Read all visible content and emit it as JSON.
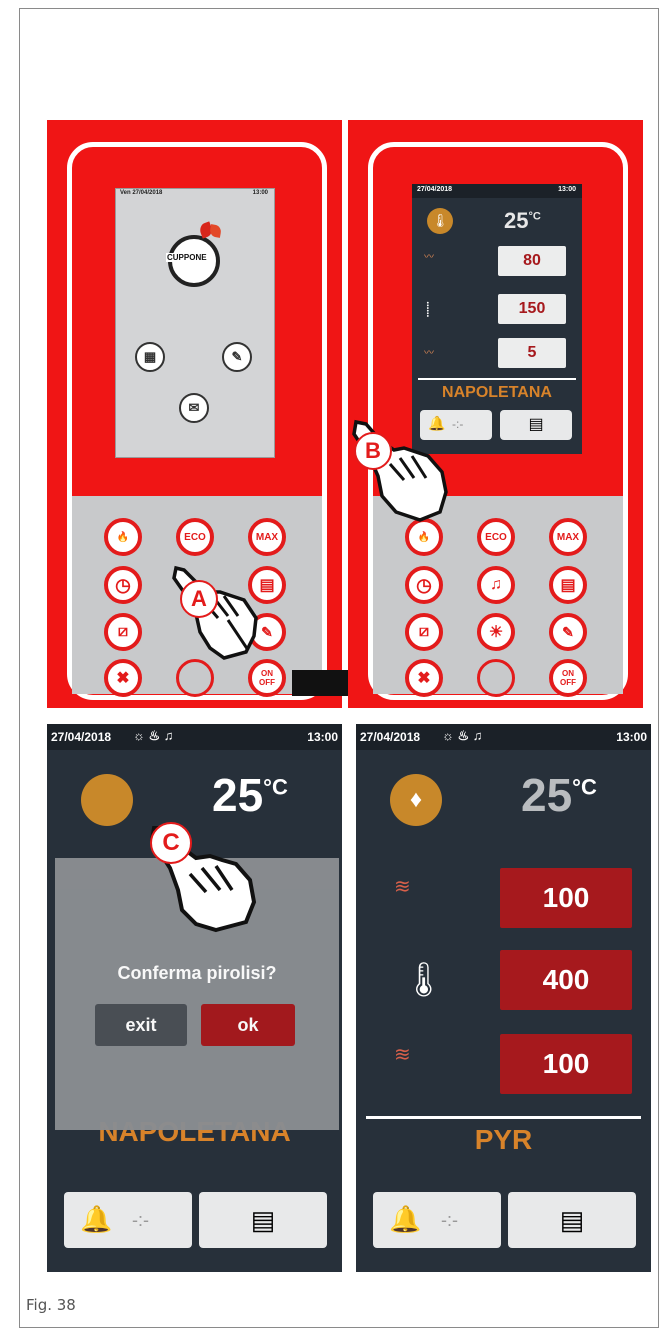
{
  "figure_caption": "Fig. 38",
  "panel_a": {
    "date": "Ven 27/04/2018",
    "time": "13:00",
    "logo_text": "CUPPONE",
    "callout": "A"
  },
  "panel_b": {
    "date": "27/04/2018",
    "time": "13:00",
    "temp_value": "25",
    "temp_unit": "°C",
    "values": [
      "80",
      "150",
      "5"
    ],
    "program": "NAPOLETANA",
    "timer": "-:-",
    "callout": "B"
  },
  "keypad": {
    "eco_label": "ECO",
    "max_label": "MAX",
    "on_label": "ON",
    "off_label": "OFF"
  },
  "screen_c": {
    "date": "27/04/2018",
    "time": "13:00",
    "temp_value": "25",
    "temp_unit": "°C",
    "dialog_text": "Conferma pirolisi?",
    "exit_label": "exit",
    "ok_label": "ok",
    "program": "NAPOLETANA",
    "timer": "-:-",
    "callout": "C"
  },
  "screen_d": {
    "date": "27/04/2018",
    "time": "13:00",
    "temp_value": "25",
    "temp_unit": "°C",
    "values": [
      "100",
      "400",
      "100"
    ],
    "program": "PYR",
    "timer": "-:-"
  },
  "colors": {
    "red": "#f01515",
    "dark_red": "#a6191d",
    "screen_bg": "#27303a",
    "accent_gold": "#c8882a"
  }
}
